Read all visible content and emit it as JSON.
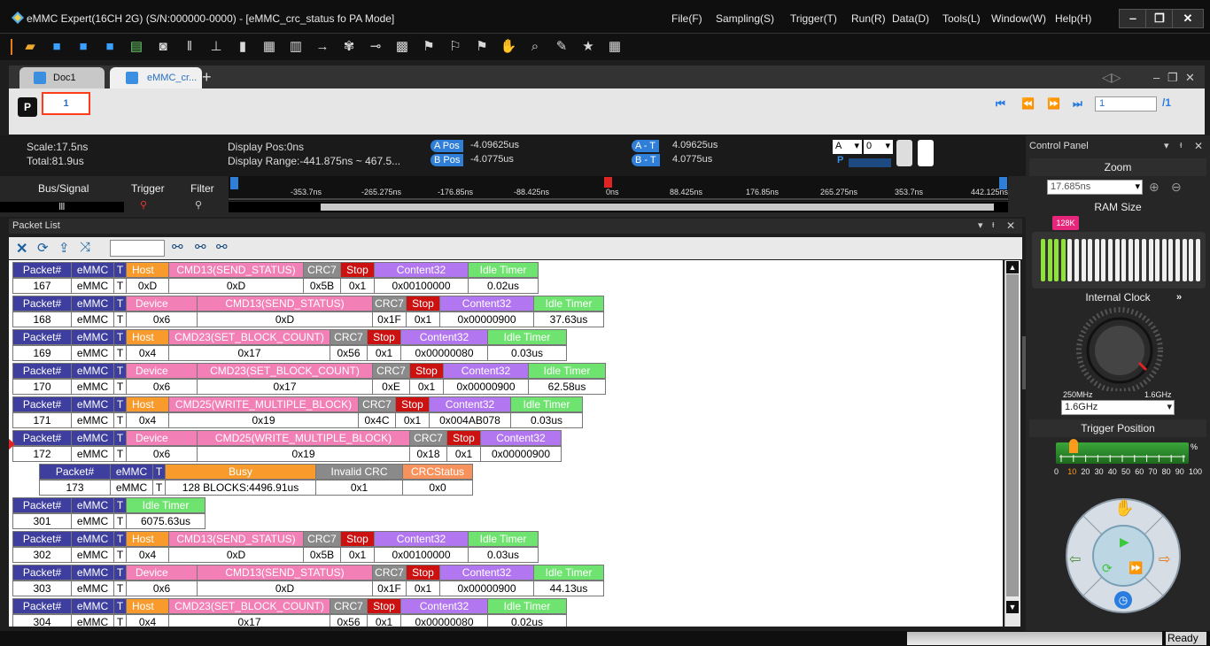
{
  "window": {
    "title": "eMMC Expert(16CH 2G) (S/N:000000-0000) - [eMMC_crc_status fo PA Mode]",
    "menus": [
      "File(F)",
      "Sampling(S)",
      "Trigger(T)",
      "Run(R)",
      "Data(D)",
      "Tools(L)",
      "Window(W)",
      "Help(H)"
    ],
    "controls": [
      "‒",
      "❐",
      "✕"
    ]
  },
  "toolbar": {
    "icons": [
      "open-folder-icon",
      "save-icon",
      "save-as-icon",
      "save-all-icon",
      "export-icon",
      "camera-icon",
      "tools-icon",
      "probe-icon",
      "database-icon",
      "grid-icon",
      "table-icon",
      "arrow-right-icon",
      "decode-icon",
      "signal-icon",
      "film-icon",
      "marker-a-icon",
      "marker-b-icon",
      "marker-c-icon",
      "hand-icon",
      "search-icon",
      "pen-icon",
      "star-icon",
      "keyboard-icon"
    ]
  },
  "tabs": [
    {
      "label": "Doc1"
    },
    {
      "label": "eMMC_cr..."
    }
  ],
  "tab_controls": [
    "◁▷",
    "–",
    "❐",
    "✕"
  ],
  "page_row": {
    "badge": "P",
    "page_value": "1",
    "nav_input": "1",
    "total": "/1"
  },
  "info": {
    "scale": "Scale:17.5ns",
    "total": "Total:81.9us",
    "display_pos": "Display Pos:0ns",
    "display_range": "Display Range:-441.875ns ~ 467.5...",
    "a_pos_label": "A Pos",
    "a_pos_value": "-4.09625us",
    "b_pos_label": "B Pos",
    "b_pos_value": "-4.0775us",
    "a_t_label": "A - T",
    "a_t_value": "4.09625us",
    "b_t_label": "B - T",
    "b_t_value": "4.0775us",
    "sel_a": "A",
    "sel_num": "0",
    "p_label": "P"
  },
  "bus": {
    "bus_signal": "Bus/Signal",
    "trigger": "Trigger",
    "filter": "Filter",
    "ticks": [
      "-353.7ns",
      "-265.275ns",
      "-176.85ns",
      "-88.425ns",
      "0ns",
      "88.425ns",
      "176.85ns",
      "265.275ns",
      "353.7ns",
      "442.125ns"
    ]
  },
  "packet_list": {
    "title": "Packet List",
    "search_value": ""
  },
  "packets": [
    {
      "num": "167",
      "dir": "Host",
      "cmd": "CMD13(SEND_STATUS)",
      "code": "0xD",
      "crc": "0x5B",
      "stop": "0x1",
      "content": "0x00100000",
      "idle": "0.02us"
    },
    {
      "num": "168",
      "dir": "Device",
      "cmd": "CMD13(SEND_STATUS)",
      "code": "0x6",
      "arg": "0xD",
      "crc": "0x1F",
      "stop": "0x1",
      "content": "0x00000900",
      "idle": "37.63us"
    },
    {
      "num": "169",
      "dir": "Host",
      "cmd": "CMD23(SET_BLOCK_COUNT)",
      "code": "0x4",
      "arg": "0x17",
      "crc": "0x56",
      "stop": "0x1",
      "content": "0x00000080",
      "idle": "0.03us"
    },
    {
      "num": "170",
      "dir": "Device",
      "cmd": "CMD23(SET_BLOCK_COUNT)",
      "code": "0x6",
      "arg": "0x17",
      "crc": "0xE",
      "stop": "0x1",
      "content": "0x00000900",
      "idle": "62.58us"
    },
    {
      "num": "171",
      "dir": "Host",
      "cmd": "CMD25(WRITE_MULTIPLE_BLOCK)",
      "code": "0x4",
      "arg": "0x19",
      "crc": "0x4C",
      "stop": "0x1",
      "content": "0x004AB078",
      "idle": "0.03us"
    },
    {
      "num": "172",
      "dir": "Device",
      "cmd": "CMD25(WRITE_MULTIPLE_BLOCK)",
      "code": "0x6",
      "arg": "0x19",
      "crc": "0x18",
      "stop": "0x1",
      "content": "0x00000900"
    },
    {
      "num": "173",
      "busy": "128 BLOCKS:4496.91us",
      "invalid": "0x1",
      "crcstatus": "0x0"
    },
    {
      "num": "301",
      "idle": "6075.63us"
    },
    {
      "num": "302",
      "dir": "Host",
      "cmd": "CMD13(SEND_STATUS)",
      "code": "0x4",
      "arg": "0xD",
      "crc": "0x5B",
      "stop": "0x1",
      "content": "0x00100000",
      "idle": "0.03us"
    },
    {
      "num": "303",
      "dir": "Device",
      "cmd": "CMD13(SEND_STATUS)",
      "code": "0x6",
      "arg": "0xD",
      "crc": "0x1F",
      "stop": "0x1",
      "content": "0x00000900",
      "idle": "44.13us"
    },
    {
      "num": "304",
      "dir": "Host",
      "cmd": "CMD23(SET_BLOCK_COUNT)",
      "code": "0x4",
      "arg": "0x17",
      "crc": "0x56",
      "stop": "0x1",
      "content": "0x00000080",
      "idle": "0.02us"
    }
  ],
  "headers": {
    "packet": "Packet#",
    "emmc": "eMMC",
    "t": "T",
    "crc7": "CRC7",
    "stop": "Stop",
    "content": "Content32",
    "idle": "Idle Timer",
    "busy": "Busy",
    "invalid": "Invalid CRC",
    "crcstatus": "CRCStatus",
    "emmc_value": "eMMC",
    "t_value": "T"
  },
  "control_panel": {
    "title": "Control Panel",
    "zoom": "Zoom",
    "zoom_value": "17.685ns",
    "ram_size": "RAM Size",
    "ram_badge": "128K",
    "internal_clock": "Internal Clock",
    "clock_min": "250MHz",
    "clock_max": "1.6GHz",
    "clock_value": "1.6GHz",
    "trigger_position": "Trigger Position",
    "trigger_value": 10,
    "percent": "%",
    "scale": [
      "0",
      "10",
      "20",
      "30",
      "40",
      "50",
      "60",
      "70",
      "80",
      "90",
      "100"
    ]
  },
  "status": {
    "text": "Ready"
  },
  "colors": {
    "accent": "#2f7fd8",
    "highlight": "#ff3b1a"
  }
}
